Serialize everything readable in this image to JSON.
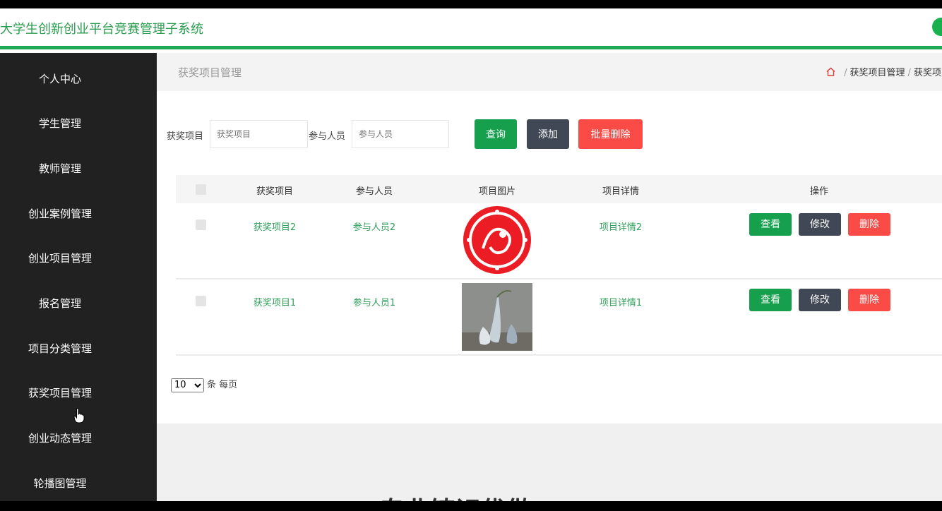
{
  "app": {
    "title": "大学生创新创业平台竞赛管理子系统"
  },
  "colors": {
    "accent": "#1fa855",
    "sidebar_bg": "#212121",
    "danger": "#fb4b47",
    "dark_button": "#404755"
  },
  "sidebar": {
    "items": [
      {
        "label": "个人中心"
      },
      {
        "label": "学生管理"
      },
      {
        "label": "教师管理"
      },
      {
        "label": "创业案例管理"
      },
      {
        "label": "创业项目管理"
      },
      {
        "label": "报名管理"
      },
      {
        "label": "项目分类管理"
      },
      {
        "label": "获奖项目管理"
      },
      {
        "label": "创业动态管理"
      },
      {
        "label": "轮播图管理"
      }
    ]
  },
  "header": {
    "page_title": "获奖项目管理",
    "breadcrumb": [
      "获奖项目管理",
      "获奖项"
    ],
    "home_icon": "home-icon"
  },
  "search": {
    "project_label": "获奖项目",
    "project_placeholder": "获奖项目",
    "members_label": "参与人员",
    "members_placeholder": "参与人员",
    "query_button": "查询",
    "add_button": "添加",
    "batch_delete_button": "批量删除"
  },
  "table": {
    "columns": [
      "获奖项目",
      "参与人员",
      "项目图片",
      "项目详情",
      "操作"
    ],
    "rows": [
      {
        "project": "获奖项目2",
        "members": "参与人员2",
        "image": "red-papercut-medallion",
        "detail": "项目详情2"
      },
      {
        "project": "获奖项目1",
        "members": "参与人员1",
        "image": "vase-photo",
        "detail": "项目详情1"
      }
    ],
    "actions": {
      "view": "查看",
      "edit": "修改",
      "delete": "删除"
    }
  },
  "pagination": {
    "page_size": "10",
    "page_size_suffix": "条 每页"
  },
  "footer": {
    "partial_heading": "专业铸识优做"
  }
}
